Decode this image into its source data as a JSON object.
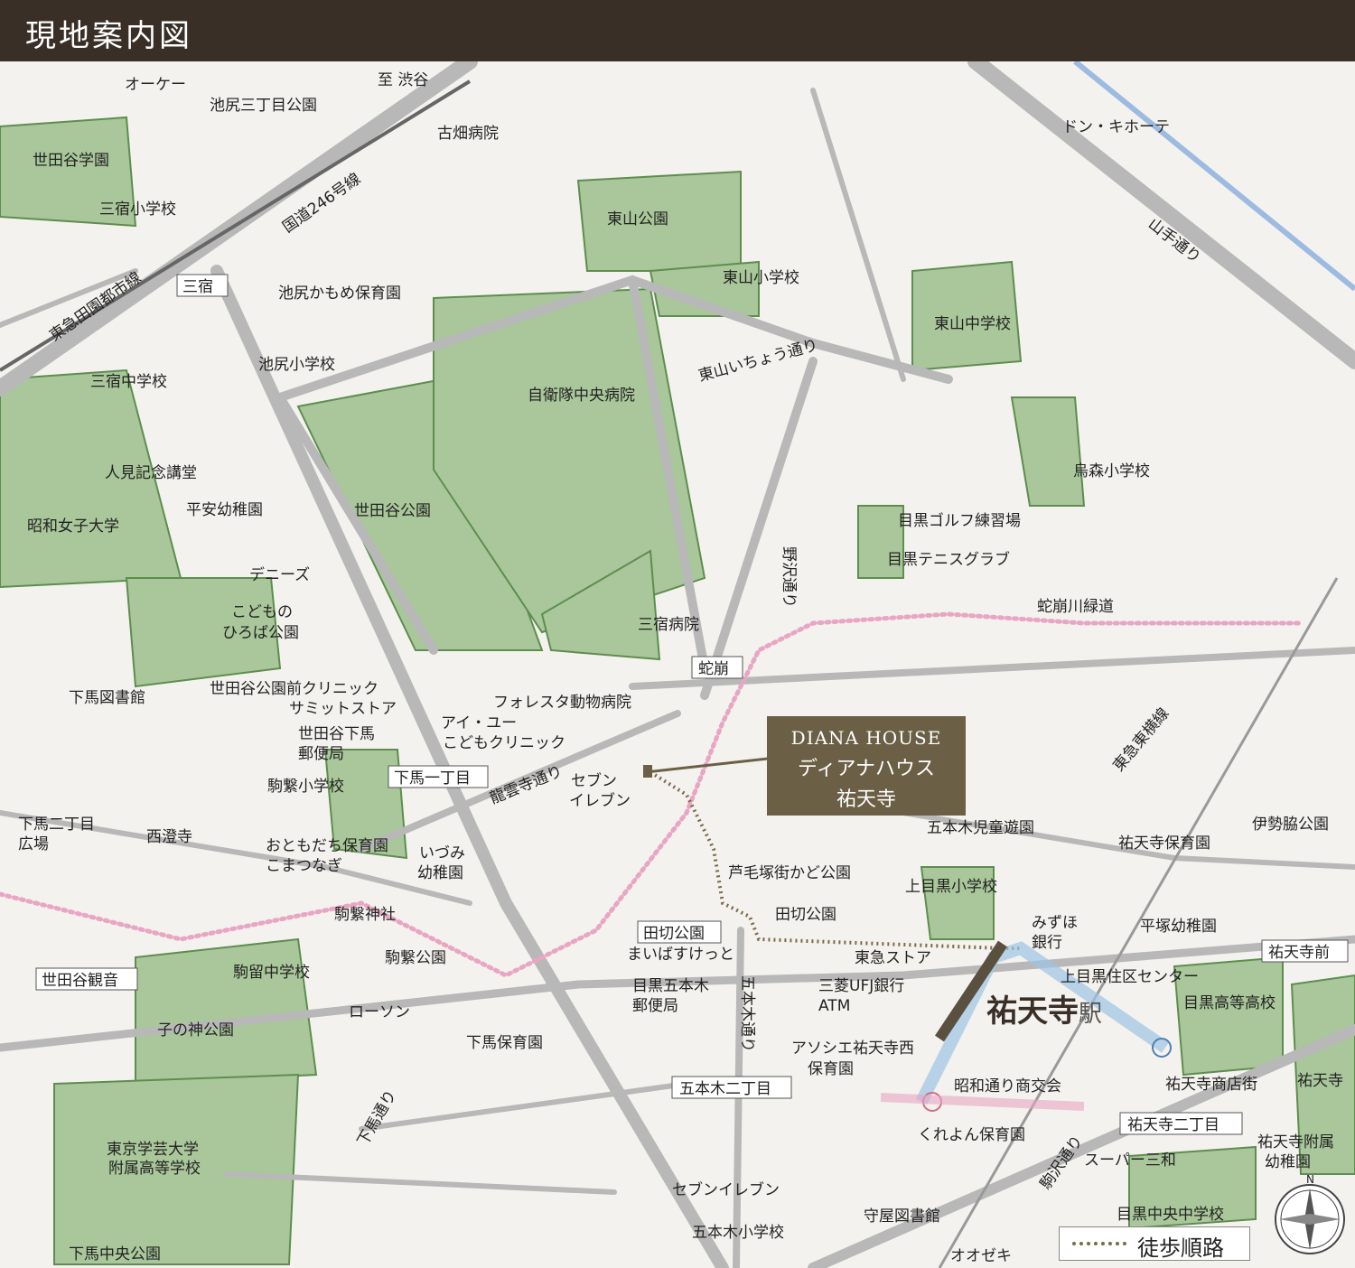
{
  "header": {
    "title": "現地案内図"
  },
  "property": {
    "name_en": "DIANA HOUSE",
    "name_ja": "ディアナハウス",
    "area": "祐天寺"
  },
  "station": {
    "name": "祐天寺",
    "suffix": "駅"
  },
  "legend": {
    "walking_route": "徒歩順路"
  },
  "compass": {
    "north": "N"
  },
  "streets": {
    "shibuya": "至 渋谷",
    "route246": "国道246号線",
    "denentoshi": "東急田園都市線",
    "yamate": "山手通り",
    "higashiyama_icho": "東山いちょう通り",
    "nozawa": "野沢通り",
    "jakuzure_ryokudo": "蛇崩川緑道",
    "toyoko": "東急東横線",
    "ryuunji": "龍雲寺通り",
    "shimouma": "下馬通り",
    "gohongi": "五本木通り",
    "komazawa": "駒沢通り"
  },
  "stations_bus": {
    "sangenjaya": "三宿",
    "jakuzure": "蛇崩",
    "shimouma1": "下馬一丁目",
    "tagiri": "田切公園",
    "setagaya_kannon": "世田谷観音",
    "gohongi2": "五本木二丁目",
    "yutenji_mae": "祐天寺前",
    "yutenji2": "祐天寺二丁目"
  },
  "pois": {
    "okay": "オーケー",
    "ikejiri3": "池尻三丁目公園",
    "furuhata": "古畑病院",
    "donki": "ドン・キホーテ",
    "setagaya_gakuen": "世田谷学園",
    "mishuku_sho": "三宿小学校",
    "higashiyama_park": "東山公園",
    "higashiyama_sho": "東山小学校",
    "ikejiri_kamome": "池尻かもめ保育園",
    "higashiyama_chu": "東山中学校",
    "ikejiri_sho": "池尻小学校",
    "mishuku_chu": "三宿中学校",
    "jieitai": "自衛隊中央病院",
    "hitomi": "人見記念講堂",
    "heian": "平安幼稚園",
    "setagaya_park": "世田谷公園",
    "showa_joshi": "昭和女子大学",
    "karasumori": "烏森小学校",
    "meguro_golf": "目黒ゴルフ練習場",
    "meguro_tennis": "目黒テニスグラブ",
    "dennys": "デニーズ",
    "kodomo1": "こどもの",
    "kodomo2": "ひろば公園",
    "mishuku_hosp": "三宿病院",
    "shimouma_lib": "下馬図書館",
    "clinic": "世田谷公園前クリニック",
    "summit": "サミットストア",
    "foresta": "フォレスタ動物病院",
    "ai_u1": "アイ・ユー",
    "ai_u2": "こどもクリニック",
    "post1": "世田谷下馬",
    "post2": "郵便局",
    "komatsunagi_sho": "駒繋小学校",
    "seven1": "セブン",
    "seven2": "イレブン",
    "shimouma2_1": "下馬二丁目",
    "shimouma2_2": "広場",
    "saichoji": "西澄寺",
    "otomodachi1": "おともだち保育園",
    "otomodachi2": "こまつなぎ",
    "izumi1": "いづみ",
    "izumi2": "幼稚園",
    "gohongi_jidou": "五本木児童遊園",
    "yutenji_hoiku": "祐天寺保育園",
    "isewaki": "伊勢脇公園",
    "ashige": "芦毛塚街かど公園",
    "kamimeguro_sho": "上目黒小学校",
    "tagiri_park": "田切公園",
    "komatsunagi_jinja": "駒繋神社",
    "mizuho1": "みずほ",
    "mizuho2": "銀行",
    "hiratsuka": "平塚幼稚園",
    "komatsunagi_park": "駒繋公園",
    "maibasket": "まいばすけっと",
    "tokyu_store": "東急ストア",
    "kamimeguro_center": "上目黒住区センター",
    "komadome": "駒留中学校",
    "meguro_post1": "目黒五本木",
    "meguro_post2": "郵便局",
    "ufj1": "三菱UFJ銀行",
    "ufj2": "ATM",
    "meguro_koko": "目黒高等高校",
    "lawson": "ローソン",
    "nenoshin": "子の神公園",
    "shimouma_hoiku": "下馬保育園",
    "associe1": "アソシエ祐天寺西",
    "associe2": "保育園",
    "showa_st": "昭和通り商交会",
    "yutenji_st": "祐天寺商店街",
    "yutenji_temple": "祐天寺",
    "crayon": "くれよん保育園",
    "gakugei1": "東京学芸大学",
    "gakugei2": "附属高等学校",
    "super_sanwa": "スーパー三和",
    "fuzoku1": "祐天寺附属",
    "fuzoku2": "幼稚園",
    "seven_b": "セブンイレブン",
    "meguro_chuo": "目黒中央中学校",
    "moriya_lib": "守屋図書館",
    "gohongi_sho": "五本木小学校",
    "shimouma_chuo": "下馬中央公園",
    "ozeki": "オオゼキ"
  },
  "colors": {
    "header": "#3a2f26",
    "park": "#a9c79a",
    "road": "#b8b8b8",
    "block": "#f4f2ee",
    "property": "#6b5f45",
    "sakura": "#e8a6c4",
    "route": "#7a6a48",
    "station_glow": "#9dc4e4"
  }
}
